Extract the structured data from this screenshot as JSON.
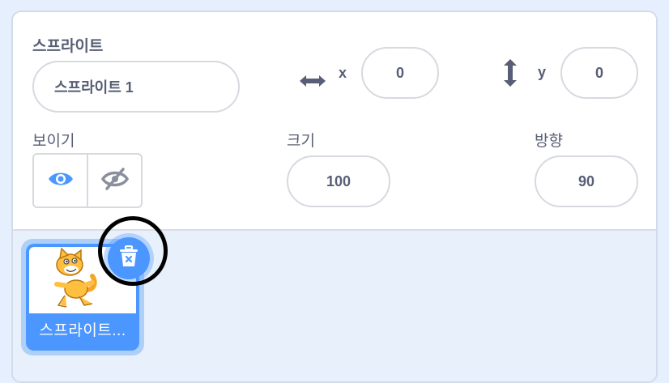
{
  "sprite_info": {
    "sprite_label": "스프라이트",
    "sprite_name": "스프라이트 1",
    "x_label": "x",
    "x_value": "0",
    "y_label": "y",
    "y_value": "0",
    "show_label": "보이기",
    "size_label": "크기",
    "size_value": "100",
    "direction_label": "방향",
    "direction_value": "90"
  },
  "sprite_list": {
    "items": [
      {
        "name": "스프라이트...",
        "selected": true
      }
    ]
  },
  "colors": {
    "accent": "#4c97ff",
    "text": "#575e75",
    "border": "#d6d9df"
  }
}
